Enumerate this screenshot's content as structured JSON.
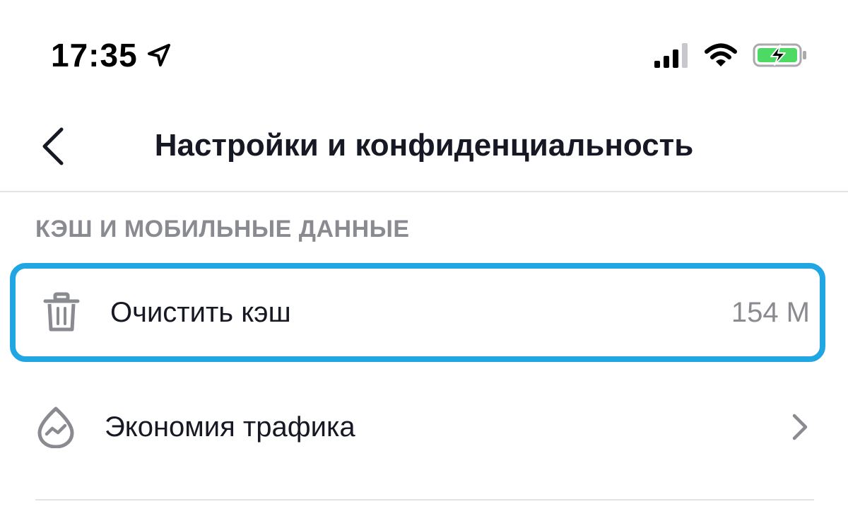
{
  "status_bar": {
    "time": "17:35",
    "icons": [
      "location-arrow-icon",
      "cellular-signal-icon",
      "wifi-icon",
      "battery-charging-icon"
    ],
    "battery_color": "#4cd964"
  },
  "header": {
    "title": "Настройки и конфиденциальность",
    "back_icon": "chevron-left-icon"
  },
  "section": {
    "title": "КЭШ И МОБИЛЬНЫЕ ДАННЫЕ",
    "items": [
      {
        "icon": "trash-icon",
        "label": "Очистить кэш",
        "value": "154 M",
        "highlighted": true
      },
      {
        "icon": "data-saver-icon",
        "label": "Экономия трафика",
        "trailing_icon": "chevron-right-icon"
      }
    ]
  },
  "colors": {
    "highlight_border": "#20a6e2",
    "primary_text": "#161823",
    "secondary_text": "#8a8b91",
    "divider": "#e3e3e4"
  }
}
